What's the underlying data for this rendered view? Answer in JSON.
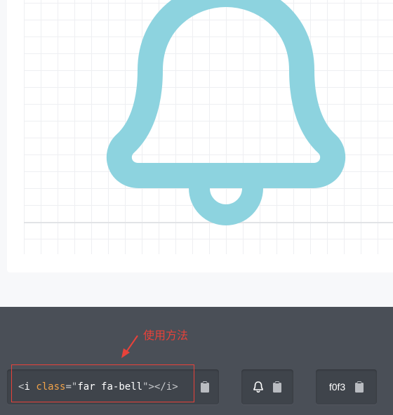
{
  "preview": {
    "icon": "bell-icon",
    "icon_color": "#8dd3df"
  },
  "annotation": {
    "text": "使用方法",
    "color": "#e8423a"
  },
  "usage": {
    "code": {
      "open": "<",
      "tag": "i",
      "space": " ",
      "attr": "class",
      "eq": "=",
      "quote_open": "\"",
      "value": "far fa-bell",
      "quote_close": "\"",
      "close": "></i>"
    },
    "copy_icon": "clipboard-icon"
  },
  "glyph": {
    "icon": "bell-icon",
    "copy_icon": "clipboard-icon"
  },
  "unicode": {
    "value": "f0f3",
    "copy_icon": "clipboard-icon"
  }
}
